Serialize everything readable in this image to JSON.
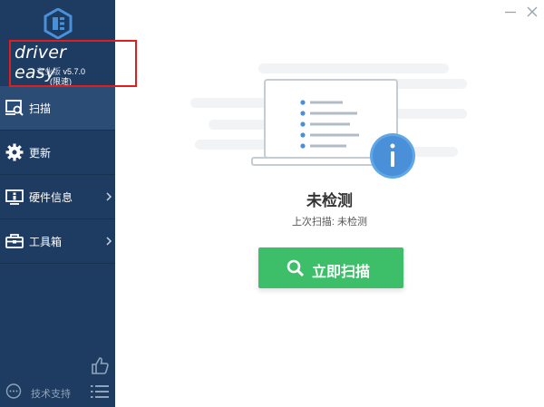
{
  "brand": {
    "name": "driver easy",
    "edition": "专业版",
    "version": "v5.7.0",
    "limited": "(限速)"
  },
  "nav": {
    "items": [
      {
        "label": "扫描",
        "icon": "scan-icon",
        "active": true
      },
      {
        "label": "更新",
        "icon": "gear-icon",
        "active": false
      },
      {
        "label": "硬件信息",
        "icon": "hardware-icon",
        "active": false
      },
      {
        "label": "工具箱",
        "icon": "toolbox-icon",
        "active": false
      }
    ],
    "support_label": "技术支持"
  },
  "main": {
    "status_title": "未检测",
    "status_sub": "上次扫描: 未检测",
    "scan_button": "立即扫描"
  },
  "colors": {
    "sidebar": "#1e3c61",
    "active_item": "#2b4d75",
    "scan_button": "#3dbf6a",
    "info_badge": "#4a90d9",
    "highlight_box": "#e21d1d"
  }
}
